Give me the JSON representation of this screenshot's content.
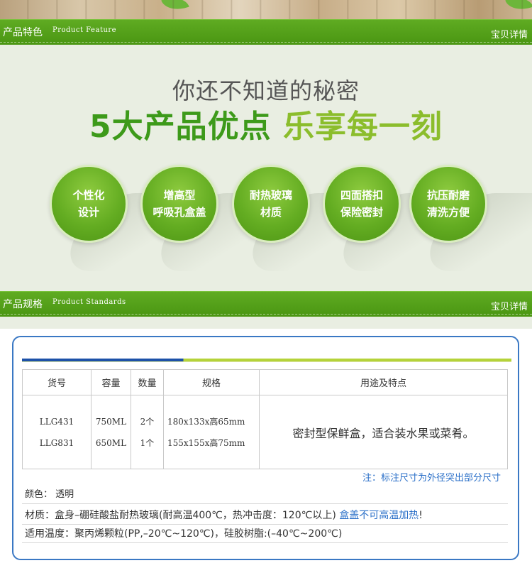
{
  "feature_section": {
    "cn_title": "产品特色",
    "en_title": "Product Feature",
    "right_link": "宝贝详情"
  },
  "headline": {
    "line1": "你还不知道的秘密",
    "line2_part1": "5大产品优点",
    "line2_part2": "乐享每一刻"
  },
  "features": [
    {
      "line1": "个性化",
      "line2": "设计"
    },
    {
      "line1": "增高型",
      "line2": "呼吸孔盒盖"
    },
    {
      "line1": "耐热玻璃",
      "line2": "材质"
    },
    {
      "line1": "四面搭扣",
      "line2": "保险密封"
    },
    {
      "line1": "抗压耐磨",
      "line2": "清洗方便"
    }
  ],
  "standards_section": {
    "cn_title": "产品规格",
    "en_title": "Product Standards",
    "right_link": "宝贝详情"
  },
  "colors": {
    "green": "#4a9612",
    "blue_border": "#3a78c4",
    "note_blue": "#2a6fc8"
  },
  "spec_table": {
    "headers": [
      "货号",
      "容量",
      "数量",
      "规格",
      "用途及特点"
    ],
    "rows": [
      {
        "sku": "LLG431",
        "capacity": "750ML",
        "qty": "2个",
        "size": "180x133x高65mm"
      },
      {
        "sku": "LLG831",
        "capacity": "650ML",
        "qty": "1个",
        "size": "155x155x高75mm"
      }
    ],
    "purpose": "密封型保鲜盒，适合装水果或菜肴。"
  },
  "note": "注：标注尺寸为外径突出部分尺寸",
  "info": {
    "color_label": "颜色：",
    "color_value": "透明",
    "material": "材质：盒身–硼硅酸盐耐热玻璃(耐高温400℃，热冲击度：120℃以上)",
    "material_warning": "盒盖不可高温加热",
    "material_end": "!",
    "temp": "适用温度：聚丙烯颗粒(PP,–20℃~120℃)，硅胶树脂:(–40℃~200℃)"
  }
}
